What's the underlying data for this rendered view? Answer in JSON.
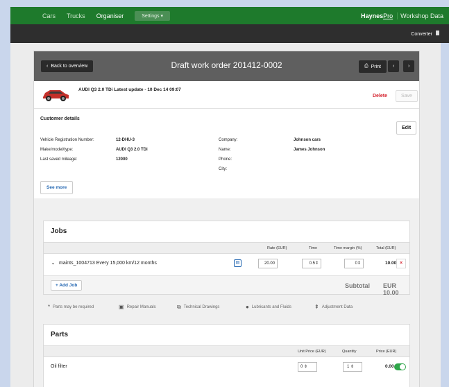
{
  "topnav": {
    "items": [
      "Cars",
      "Trucks",
      "Organiser"
    ],
    "settings_label": "Settings",
    "brand_bold": "Haynes",
    "brand_link": "Pro",
    "workshop": "Workshop Data"
  },
  "secbar": {
    "converter": "Converter"
  },
  "header": {
    "back_label": "Back to overview",
    "title": "Draft work order 201412-0002",
    "print_label": "Print"
  },
  "car": {
    "info": "AUDI Q3 2.0 TDi Latest update - 10 Dec 14 09:07",
    "delete_label": "Delete",
    "save_label": "Save"
  },
  "customer": {
    "heading": "Customer details",
    "edit_label": "Edit",
    "left": [
      {
        "label": "Vehicle Registration Number:",
        "value": "12-DHU-3"
      },
      {
        "label": "Make/model/type:",
        "value": "AUDI Q3 2.0 TDi"
      },
      {
        "label": "Last saved mileage:",
        "value": "12000"
      }
    ],
    "right": [
      {
        "label": "Company:",
        "value": "Johnson cars"
      },
      {
        "label": "Name:",
        "value": "James Johnson"
      },
      {
        "label": "Phone:",
        "value": ""
      },
      {
        "label": "City:",
        "value": ""
      }
    ],
    "see_more": "See more"
  },
  "jobs": {
    "heading": "Jobs",
    "columns": {
      "rate": "Rate (EUR)",
      "time": "Time",
      "margin": "Time margin (%)",
      "total": "Total (EUR)"
    },
    "rows": [
      {
        "name": "maints_1004713 Every 15,000 km/12 months",
        "rate": "20.00",
        "time": "0.5",
        "margin": "0",
        "total": "10.00"
      }
    ],
    "add_label": "+ Add Job",
    "subtotal_label": "Subtotal",
    "subtotal_value": "EUR  10.00"
  },
  "links": {
    "parts_required": "Parts may be required",
    "repair_manuals": "Repair Manuals",
    "technical_drawings": "Technical Drawings",
    "lubricants": "Lubricants and Fluids",
    "adjustment": "Adjustment Data"
  },
  "parts": {
    "heading": "Parts",
    "columns": {
      "unit_price": "Unit Price (EUR)",
      "quantity": "Quantity",
      "price": "Price (EUR)"
    },
    "rows": [
      {
        "name": "Oil filter",
        "unit_price": "0",
        "quantity": "1",
        "price": "0.00",
        "enabled": true
      }
    ]
  },
  "colors": {
    "nav_green": "#1e7a2c",
    "accent_blue": "#1f64b0",
    "delete_red": "#d4202c",
    "toggle_green": "#2fa64a"
  }
}
